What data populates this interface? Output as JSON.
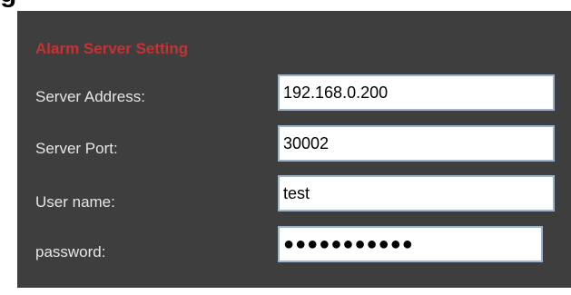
{
  "section": {
    "heading_partial": "...g...",
    "title": "Alarm Server Setting"
  },
  "form": {
    "server_address": {
      "label": "Server Address:",
      "value": "192.168.0.200"
    },
    "server_port": {
      "label": "Server Port:",
      "value": "30002"
    },
    "user_name": {
      "label": "User name:",
      "value": "test"
    },
    "password": {
      "label": "password:",
      "value": "●●●●●●●●●●●"
    }
  },
  "colors": {
    "panel_background": "#3e3e3e",
    "title_red": "#c83232",
    "label_text": "#e6e6e6",
    "field_border": "#9ab3cf"
  }
}
